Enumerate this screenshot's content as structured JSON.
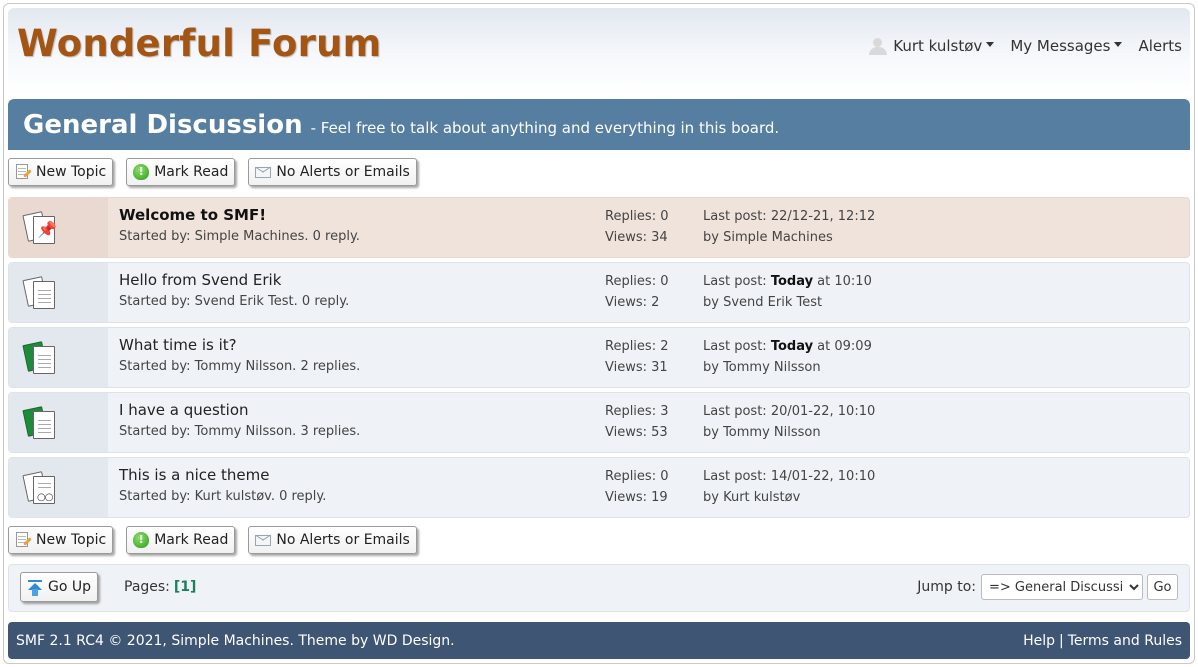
{
  "header": {
    "forum_title": "Wonderful Forum",
    "user_menu": {
      "username": "Kurt kulstøv",
      "messages": "My Messages",
      "alerts": "Alerts"
    }
  },
  "board": {
    "name": "General Discussion",
    "description": "- Feel free to talk about anything and everything in this board."
  },
  "buttons": {
    "new_topic": "New Topic",
    "mark_read": "Mark Read",
    "notify": "No Alerts or Emails"
  },
  "topics": [
    {
      "subject": "Welcome to SMF!",
      "starter": "Started by: Simple Machines. 0 reply.",
      "replies": "Replies: 0",
      "views": "Views: 34",
      "last_prefix": "Last post: ",
      "last_bold": "",
      "last_suffix": "22/12-21, 12:12",
      "last_by": "by Simple Machines",
      "icon": "sticky-pin-icon",
      "sticky": true
    },
    {
      "subject": "Hello from Svend Erik",
      "starter": "Started by: Svend Erik Test. 0 reply.",
      "replies": "Replies: 0",
      "views": "Views: 2",
      "last_prefix": "Last post: ",
      "last_bold": "Today",
      "last_suffix": " at 10:10",
      "last_by": "by Svend Erik Test",
      "icon": "normal-topic-icon"
    },
    {
      "subject": "What time is it?",
      "starter": "Started by: Tommy Nilsson. 2 replies.",
      "replies": "Replies: 2",
      "views": "Views: 31",
      "last_prefix": "Last post: ",
      "last_bold": "Today",
      "last_suffix": " at 09:09",
      "last_by": "by Tommy Nilsson",
      "icon": "my-topic-icon"
    },
    {
      "subject": "I have a question",
      "starter": "Started by: Tommy Nilsson. 3 replies.",
      "replies": "Replies: 3",
      "views": "Views: 53",
      "last_prefix": "Last post: ",
      "last_bold": "",
      "last_suffix": "20/01-22, 10:10",
      "last_by": "by Tommy Nilsson",
      "icon": "my-topic-icon"
    },
    {
      "subject": "This is a nice theme",
      "starter": "Started by: Kurt kulstøv. 0 reply.",
      "replies": "Replies: 0",
      "views": "Views: 19",
      "last_prefix": "Last post: ",
      "last_bold": "",
      "last_suffix": "14/01-22, 10:10",
      "last_by": "by Kurt kulstøv",
      "icon": "poll-topic-icon"
    }
  ],
  "pager": {
    "go_up": "Go Up",
    "pages_label": "Pages:",
    "current_page": "[1]",
    "jump_label": "Jump to:",
    "jump_selected": "=> General Discussion",
    "go": "Go"
  },
  "footer": {
    "copyright": "SMF 2.1 RC4 © 2021, Simple Machines. Theme by WD Design.",
    "help": "Help",
    "separator": "|",
    "terms": "Terms and Rules"
  },
  "colors": {
    "title": "#a45514",
    "board_header": "#557ea0",
    "sticky_row": "#f0e3dc",
    "row": "#eff3f7",
    "footer": "#3e5573",
    "page_link": "#1c7f5e"
  }
}
